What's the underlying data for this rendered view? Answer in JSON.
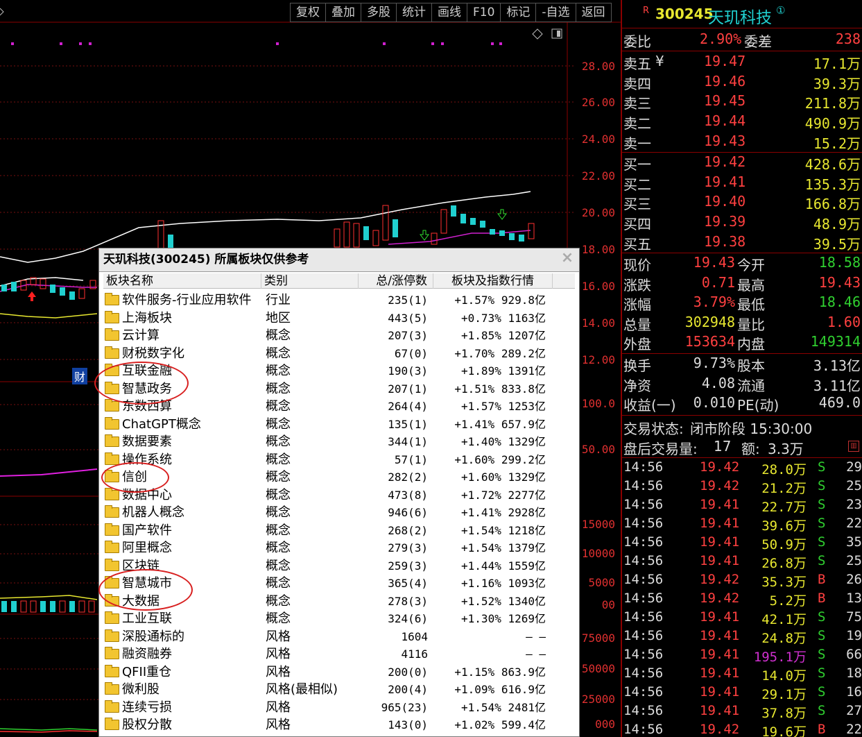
{
  "toolbar": {
    "items": [
      "复权",
      "叠加",
      "多股",
      "统计",
      "画线",
      "F10",
      "标记",
      "-自选",
      "返回"
    ]
  },
  "price_axis": [
    "28.00",
    "26.00",
    "24.00",
    "22.00",
    "20.00",
    "18.00",
    "16.00",
    "14.00",
    "12.00"
  ],
  "indicator_axis": [
    "100.0",
    "50.00"
  ],
  "volume_axis": [
    "15000",
    "10000",
    "5000",
    "00"
  ],
  "volume_axis2": [
    "75000",
    "50000",
    "25000",
    "000"
  ],
  "chart_marker": "财",
  "stock": {
    "badge": "R",
    "code": "300245",
    "name": "天玑科技",
    "circle": "①"
  },
  "weibi": {
    "label1": "委比",
    "value1": "2.90%",
    "label2": "委差",
    "value2": "238"
  },
  "sells": [
    {
      "label": "卖五",
      "extra": "¥",
      "price": "19.47",
      "vol": "17.1万"
    },
    {
      "label": "卖四",
      "extra": "",
      "price": "19.46",
      "vol": "39.3万"
    },
    {
      "label": "卖三",
      "extra": "",
      "price": "19.45",
      "vol": "211.8万"
    },
    {
      "label": "卖二",
      "extra": "",
      "price": "19.44",
      "vol": "490.9万"
    },
    {
      "label": "卖一",
      "extra": "",
      "price": "19.43",
      "vol": "15.2万"
    }
  ],
  "buys": [
    {
      "label": "买一",
      "price": "19.42",
      "vol": "428.6万"
    },
    {
      "label": "买二",
      "price": "19.41",
      "vol": "135.3万"
    },
    {
      "label": "买三",
      "price": "19.40",
      "vol": "166.8万"
    },
    {
      "label": "买四",
      "price": "19.39",
      "vol": "48.9万"
    },
    {
      "label": "买五",
      "price": "19.38",
      "vol": "39.5万"
    }
  ],
  "stats": [
    {
      "l1": "现价",
      "v1": "19.43",
      "l2": "今开",
      "v2": "18.58",
      "c1": "#ff4040",
      "c2": "#30d030"
    },
    {
      "l1": "涨跌",
      "v1": "0.71",
      "l2": "最高",
      "v2": "19.43",
      "c1": "#ff4040",
      "c2": "#ff4040"
    },
    {
      "l1": "涨幅",
      "v1": "3.79%",
      "l2": "最低",
      "v2": "18.46",
      "c1": "#ff4040",
      "c2": "#30d030"
    },
    {
      "l1": "总量",
      "v1": "302948",
      "l2": "量比",
      "v2": "1.60",
      "c1": "#e8e830",
      "c2": "#ff4040"
    },
    {
      "l1": "外盘",
      "v1": "153634",
      "l2": "内盘",
      "v2": "149314",
      "c1": "#ff4040",
      "c2": "#30d030"
    }
  ],
  "stats2": [
    {
      "l1": "换手",
      "v1": "9.73%",
      "l2": "股本",
      "v2": "3.13亿"
    },
    {
      "l1": "净资",
      "v1": "4.08",
      "l2": "流通",
      "v2": "3.11亿"
    },
    {
      "l1": "收益(一)",
      "v1": "0.010",
      "l2": "PE(动)",
      "v2": "469.0"
    }
  ],
  "status": {
    "label": "交易状态:",
    "value": "闭市阶段 15:30:00",
    "after_label": "盘后交易量:",
    "after_vol": "17",
    "amount_label": "额:",
    "amount": "3.3万"
  },
  "ticks": [
    {
      "time": "14:56",
      "price": "19.42",
      "vol": "28.0万",
      "bs": "S",
      "n": "29",
      "pc": "#ff4040",
      "vc": "#e8e830"
    },
    {
      "time": "14:56",
      "price": "19.42",
      "vol": "21.2万",
      "bs": "S",
      "n": "25",
      "pc": "#ff4040",
      "vc": "#e8e830"
    },
    {
      "time": "14:56",
      "price": "19.41",
      "vol": "22.7万",
      "bs": "S",
      "n": "23",
      "pc": "#ff4040",
      "vc": "#e8e830"
    },
    {
      "time": "14:56",
      "price": "19.41",
      "vol": "39.6万",
      "bs": "S",
      "n": "22",
      "pc": "#ff4040",
      "vc": "#e8e830"
    },
    {
      "time": "14:56",
      "price": "19.41",
      "vol": "50.9万",
      "bs": "S",
      "n": "35",
      "pc": "#ff4040",
      "vc": "#e8e830"
    },
    {
      "time": "14:56",
      "price": "19.41",
      "vol": "26.8万",
      "bs": "S",
      "n": "25",
      "pc": "#ff4040",
      "vc": "#e8e830"
    },
    {
      "time": "14:56",
      "price": "19.42",
      "vol": "35.3万",
      "bs": "B",
      "n": "26",
      "pc": "#ff4040",
      "vc": "#e8e830"
    },
    {
      "time": "14:56",
      "price": "19.42",
      "vol": "5.2万",
      "bs": "B",
      "n": "13",
      "pc": "#ff4040",
      "vc": "#e8e830"
    },
    {
      "time": "14:56",
      "price": "19.41",
      "vol": "42.1万",
      "bs": "S",
      "n": "75",
      "pc": "#ff4040",
      "vc": "#e8e830"
    },
    {
      "time": "14:56",
      "price": "19.41",
      "vol": "24.8万",
      "bs": "S",
      "n": "19",
      "pc": "#ff4040",
      "vc": "#e8e830"
    },
    {
      "time": "14:56",
      "price": "19.41",
      "vol": "195.1万",
      "bs": "S",
      "n": "66",
      "pc": "#ff4040",
      "vc": "#d030d0"
    },
    {
      "time": "14:56",
      "price": "19.41",
      "vol": "14.0万",
      "bs": "S",
      "n": "18",
      "pc": "#ff4040",
      "vc": "#e8e830"
    },
    {
      "time": "14:56",
      "price": "19.41",
      "vol": "29.1万",
      "bs": "S",
      "n": "16",
      "pc": "#ff4040",
      "vc": "#e8e830"
    },
    {
      "time": "14:56",
      "price": "19.41",
      "vol": "37.8万",
      "bs": "S",
      "n": "27",
      "pc": "#ff4040",
      "vc": "#e8e830"
    },
    {
      "time": "14:56",
      "price": "19.42",
      "vol": "19.6万",
      "bs": "B",
      "n": "22",
      "pc": "#ff4040",
      "vc": "#e8e830"
    }
  ],
  "popup": {
    "title": "天玑科技(300245)  所属板块仅供参考",
    "close": "×",
    "headers": [
      "板块名称",
      "类别",
      "总/涨停数",
      "板块及指数行情"
    ],
    "rows": [
      {
        "name": "软件服务-行业应用软件",
        "type": "行业",
        "count": "235(1)",
        "quote": "+1.57% 929.8亿"
      },
      {
        "name": "上海板块",
        "type": "地区",
        "count": "443(5)",
        "quote": "+0.73% 1163亿"
      },
      {
        "name": "云计算",
        "type": "概念",
        "count": "207(3)",
        "quote": "+1.85% 1207亿"
      },
      {
        "name": "财税数字化",
        "type": "概念",
        "count": "67(0)",
        "quote": "+1.70% 289.2亿"
      },
      {
        "name": "互联金融",
        "type": "概念",
        "count": "190(3)",
        "quote": "+1.89% 1391亿"
      },
      {
        "name": "智慧政务",
        "type": "概念",
        "count": "207(1)",
        "quote": "+1.51% 833.8亿"
      },
      {
        "name": "东数西算",
        "type": "概念",
        "count": "264(4)",
        "quote": "+1.57% 1253亿"
      },
      {
        "name": "ChatGPT概念",
        "type": "概念",
        "count": "135(1)",
        "quote": "+1.41% 657.9亿"
      },
      {
        "name": "数据要素",
        "type": "概念",
        "count": "344(1)",
        "quote": "+1.40% 1329亿"
      },
      {
        "name": "操作系统",
        "type": "概念",
        "count": "57(1)",
        "quote": "+1.60% 299.2亿"
      },
      {
        "name": "信创",
        "type": "概念",
        "count": "282(2)",
        "quote": "+1.60% 1329亿"
      },
      {
        "name": "数据中心",
        "type": "概念",
        "count": "473(8)",
        "quote": "+1.72% 2277亿"
      },
      {
        "name": "机器人概念",
        "type": "概念",
        "count": "946(6)",
        "quote": "+1.41% 2928亿"
      },
      {
        "name": "国产软件",
        "type": "概念",
        "count": "268(2)",
        "quote": "+1.54% 1218亿"
      },
      {
        "name": "阿里概念",
        "type": "概念",
        "count": "279(3)",
        "quote": "+1.54% 1379亿"
      },
      {
        "name": "区块链",
        "type": "概念",
        "count": "259(3)",
        "quote": "+1.44% 1559亿"
      },
      {
        "name": "智慧城市",
        "type": "概念",
        "count": "365(4)",
        "quote": "+1.16% 1093亿"
      },
      {
        "name": "大数据",
        "type": "概念",
        "count": "278(3)",
        "quote": "+1.52% 1340亿"
      },
      {
        "name": "工业互联",
        "type": "概念",
        "count": "324(6)",
        "quote": "+1.30% 1269亿"
      },
      {
        "name": "深股通标的",
        "type": "风格",
        "count": "1604",
        "quote": "— —"
      },
      {
        "name": "融资融券",
        "type": "风格",
        "count": "4116",
        "quote": "— —"
      },
      {
        "name": "QFII重仓",
        "type": "风格",
        "count": "200(0)",
        "quote": "+1.15% 863.9亿"
      },
      {
        "name": "微利股",
        "type": "风格(最相似)",
        "count": "200(4)",
        "quote": "+1.09% 616.9亿"
      },
      {
        "name": "连续亏损",
        "type": "风格",
        "count": "965(23)",
        "quote": "+1.54% 2481亿"
      },
      {
        "name": "股权分散",
        "type": "风格",
        "count": "143(0)",
        "quote": "+1.02% 599.4亿"
      }
    ]
  }
}
